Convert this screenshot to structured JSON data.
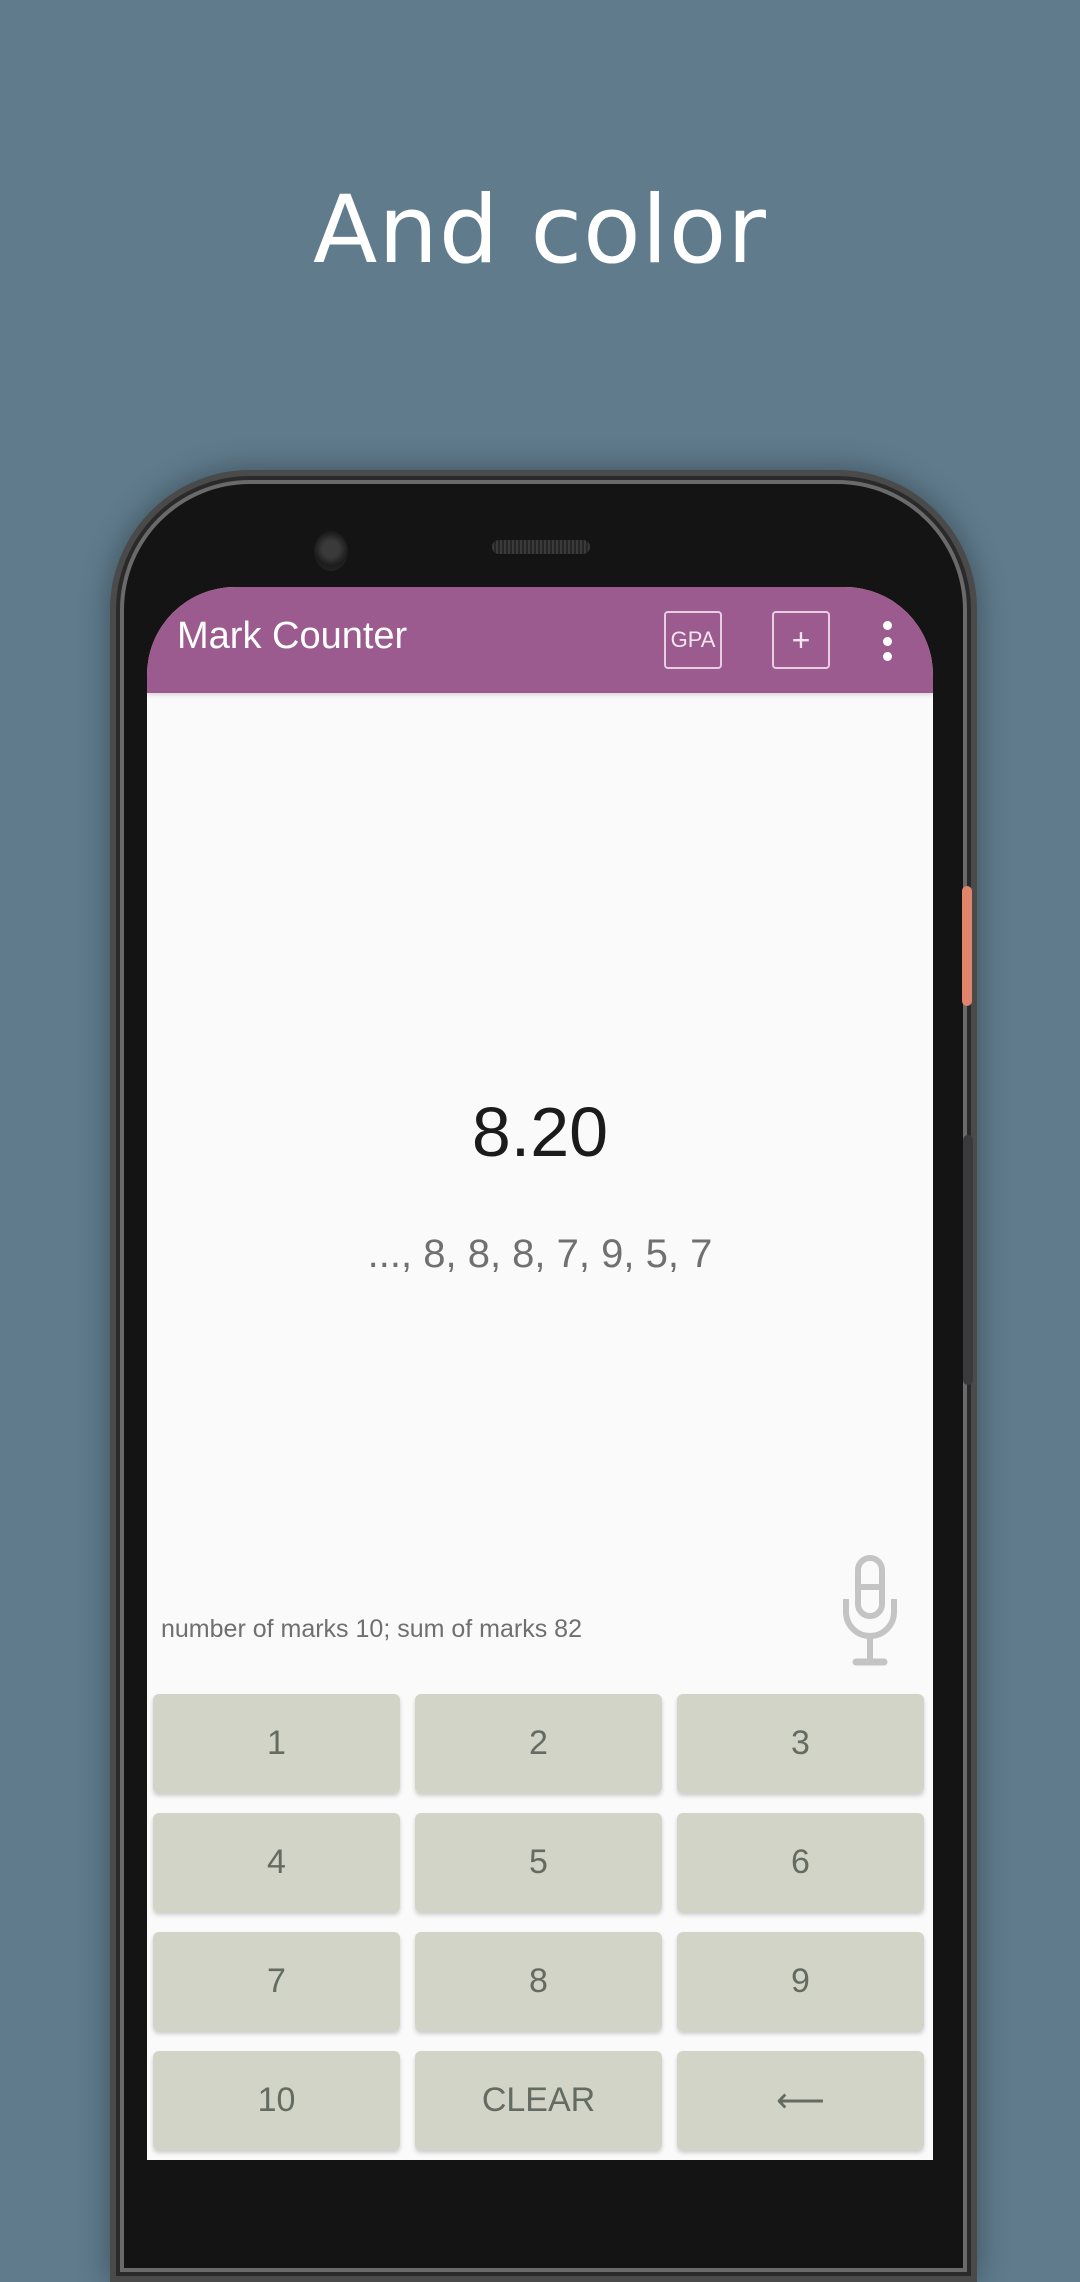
{
  "promo": {
    "headline": "And color"
  },
  "colors": {
    "background": "#5f7b8c",
    "appbar": "#9b5b8e",
    "key_bg": "#d3d4c8",
    "key_text": "#636b62",
    "side_button": "#e0856c"
  },
  "app": {
    "title": "Mark Counter",
    "actions": {
      "gpa_label": "GPA",
      "add_label": "+",
      "more_icon": "more-vert-icon"
    }
  },
  "display": {
    "average": "8.20",
    "history": "..., 8, 8, 8, 7, 9, 5, 7",
    "stats": "number of marks 10;  sum of marks 82",
    "mic_icon": "microphone-icon"
  },
  "keypad": {
    "keys": [
      "1",
      "2",
      "3",
      "4",
      "5",
      "6",
      "7",
      "8",
      "9",
      "10",
      "CLEAR",
      "⟵"
    ]
  }
}
